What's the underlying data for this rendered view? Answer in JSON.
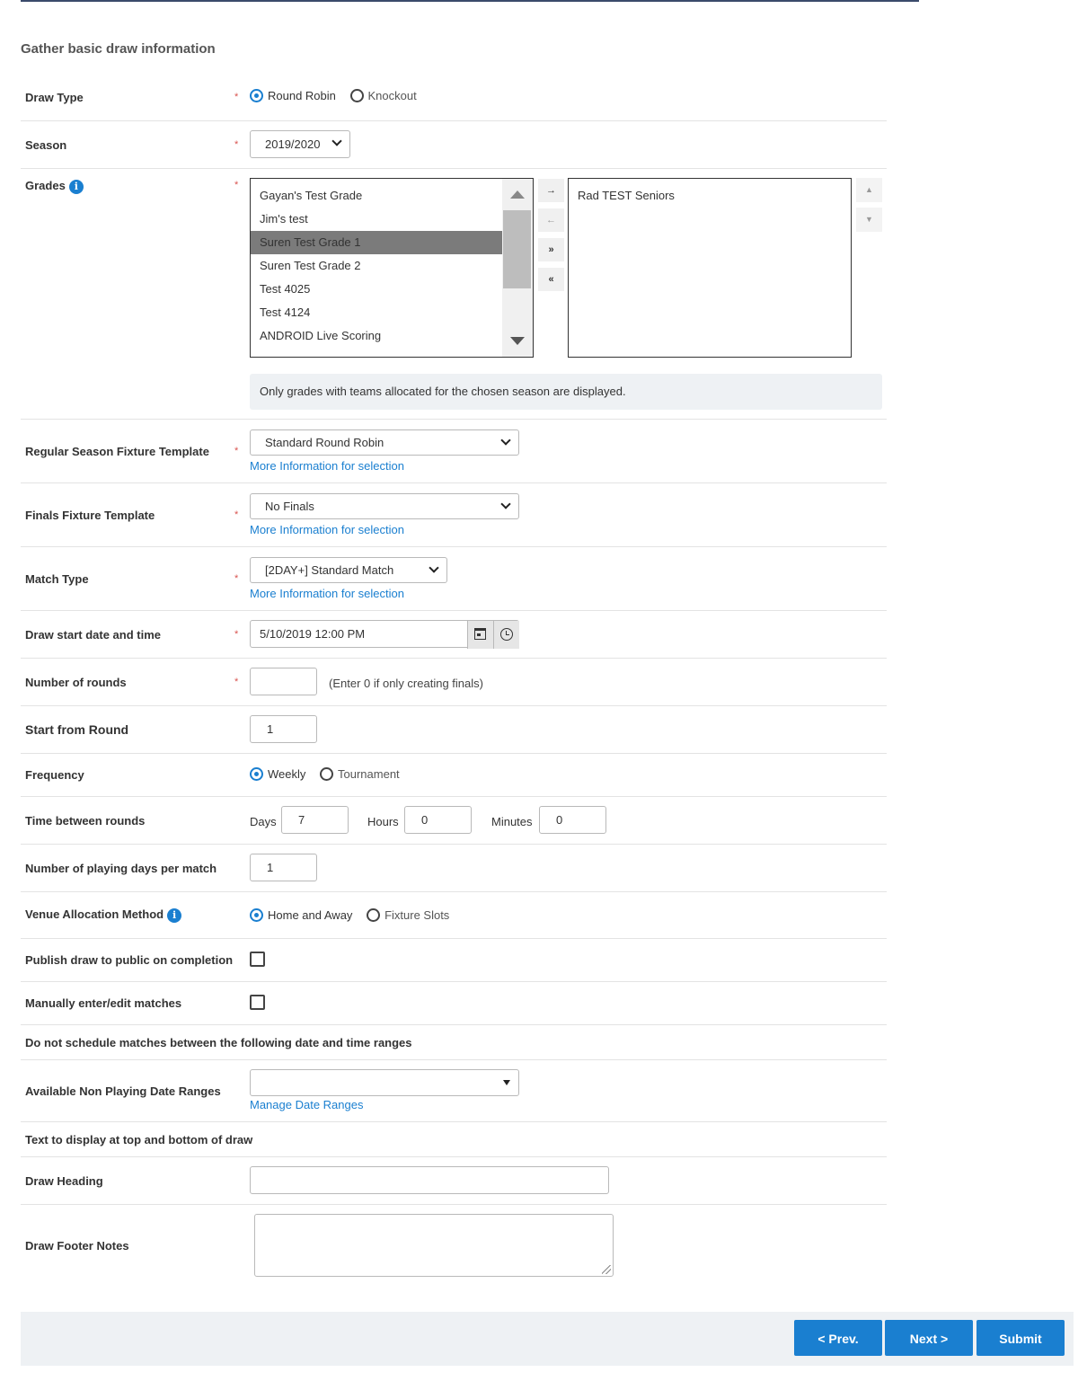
{
  "section_title": "Gather basic draw information",
  "draw_type": {
    "label": "Draw Type",
    "options": [
      "Round Robin",
      "Knockout"
    ],
    "selected": "Round Robin"
  },
  "season": {
    "label": "Season",
    "value": "2019/2020"
  },
  "grades": {
    "label": "Grades",
    "info_icon": "info-icon",
    "available": [
      "Gayan's Test Grade",
      "Jim's test",
      "Suren Test Grade 1",
      "Suren Test Grade 2",
      "Test 4025",
      "Test 4124",
      "ANDROID Live Scoring"
    ],
    "selected_available": "Suren Test Grade 1",
    "chosen": [
      "Rad TEST Seniors"
    ],
    "move_buttons": [
      "→",
      "←",
      "»",
      "«"
    ],
    "notice": "Only grades with teams allocated for the chosen season are displayed."
  },
  "regular_template": {
    "label": "Regular Season Fixture Template",
    "value": "Standard Round Robin",
    "link": "More Information for selection"
  },
  "finals_template": {
    "label": "Finals Fixture Template",
    "value": "No Finals",
    "link": "More Information for selection"
  },
  "match_type": {
    "label": "Match Type",
    "value": "[2DAY+] Standard Match",
    "link": "More Information for selection"
  },
  "start_datetime": {
    "label": "Draw start date and time",
    "value": "5/10/2019 12:00 PM"
  },
  "rounds": {
    "label": "Number of rounds",
    "value": "",
    "hint": "(Enter 0 if only creating finals)"
  },
  "start_round": {
    "label": "Start from Round",
    "value": "1"
  },
  "frequency": {
    "label": "Frequency",
    "options": [
      "Weekly",
      "Tournament"
    ],
    "selected": "Weekly"
  },
  "time_between": {
    "label": "Time between rounds",
    "days_label": "Days",
    "days": "7",
    "hours_label": "Hours",
    "hours": "0",
    "minutes_label": "Minutes",
    "minutes": "0"
  },
  "playing_days": {
    "label": "Number of playing days per match",
    "value": "1"
  },
  "venue_allocation": {
    "label": "Venue Allocation Method",
    "options": [
      "Home and Away",
      "Fixture Slots"
    ],
    "selected": "Home and Away"
  },
  "publish": {
    "label": "Publish draw to public on completion",
    "checked": false
  },
  "manual_edit": {
    "label": "Manually enter/edit matches",
    "checked": false
  },
  "no_schedule_heading": "Do not schedule matches between the following date and time ranges",
  "non_playing": {
    "label": "Available Non Playing Date Ranges",
    "value": "",
    "link": "Manage Date Ranges"
  },
  "text_heading": "Text to display at top and bottom of draw",
  "draw_heading": {
    "label": "Draw Heading",
    "value": ""
  },
  "draw_footer": {
    "label": "Draw Footer Notes",
    "value": ""
  },
  "buttons": {
    "prev": "< Prev.",
    "next": "Next >",
    "submit": "Submit"
  },
  "colors": {
    "accent": "#1a7fd0",
    "required": "#d9534f",
    "footer_bg": "#eef1f4"
  }
}
